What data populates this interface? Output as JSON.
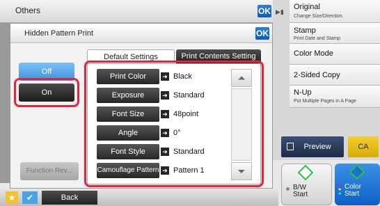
{
  "header": {
    "title": "Others",
    "ok_label": "OK"
  },
  "dialog": {
    "title": "Hidden Pattern Print",
    "ok_label": "OK"
  },
  "tabs": [
    "Default Settings",
    "Print Contents Setting"
  ],
  "side": {
    "off_label": "Off",
    "on_label": "On",
    "function_review_label": "Function Rev..."
  },
  "settings": [
    {
      "label": "Print Color",
      "value": "Black"
    },
    {
      "label": "Exposure",
      "value": "Standard"
    },
    {
      "label": "Font Size",
      "value": "48point"
    },
    {
      "label": "Angle",
      "value": "0°"
    },
    {
      "label": "Font Style",
      "value": "Standard"
    },
    {
      "label": "Camouflage Pattern",
      "value": "Pattern 1"
    }
  ],
  "right_panel": [
    {
      "main": "Original",
      "sub": "Change Size/Direction."
    },
    {
      "main": "Stamp",
      "sub": "Print Date and Stamp"
    },
    {
      "main": "Color Mode",
      "sub": ""
    },
    {
      "main": "2-Sided Copy",
      "sub": ""
    },
    {
      "main": "N-Up",
      "sub": "Put Multiple Pages in A Page"
    }
  ],
  "buttons": {
    "preview": "Preview",
    "ca": "CA",
    "back": "Back",
    "bw_start_1": "B/W",
    "bw_start_2": "Start",
    "color_start_1": "Color",
    "color_start_2": "Start"
  },
  "colors": {
    "highlight": "#e0263f",
    "accent_blue": "#0b5cb5",
    "ca_yellow": "#e6bb17"
  }
}
